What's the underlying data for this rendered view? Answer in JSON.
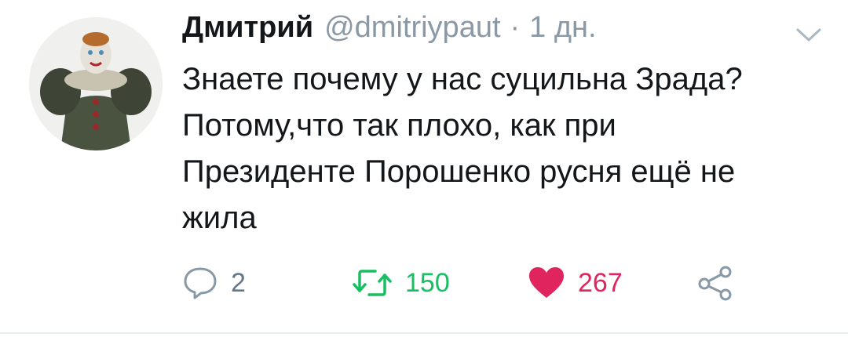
{
  "tweet": {
    "author_name": "Дмитрий",
    "author_handle": "@dmitriypaut",
    "separator": "·",
    "time": "1 дн.",
    "text_lines": [
      "Знаете почему у нас суцильна Зрада?",
      "Потому,что так плохо, как при",
      "Президенте Порошенко русня ещё не",
      "жила"
    ]
  },
  "actions": {
    "reply_count": "2",
    "retweet_count": "150",
    "like_count": "267",
    "reply_icon": "reply-bubble-icon",
    "retweet_icon": "retweet-icon",
    "like_icon": "heart-icon",
    "share_icon": "share-icon"
  },
  "colors": {
    "text": "#14171a",
    "muted": "#8b98a5",
    "retweet": "#17bf63",
    "like": "#e0245e"
  }
}
